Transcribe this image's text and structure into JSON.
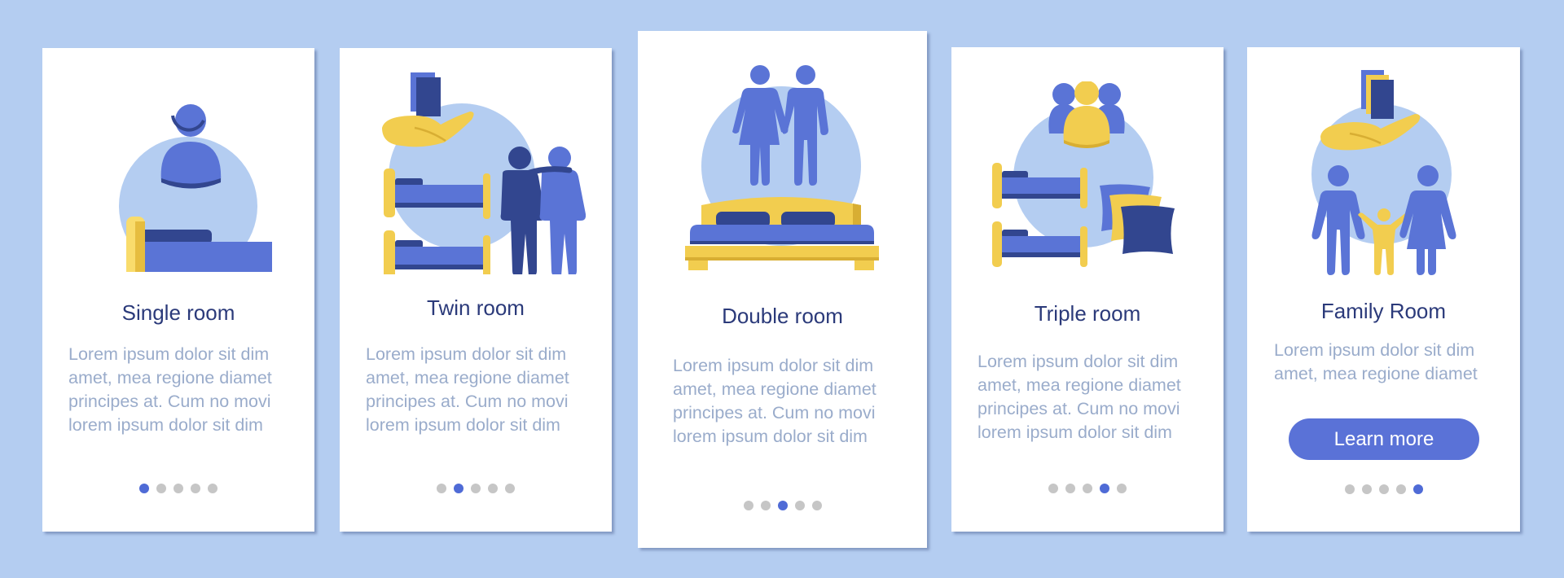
{
  "colors": {
    "background": "#b4cdf1",
    "card": "#ffffff",
    "title": "#2b3a7a",
    "body_text": "#9aaccb",
    "accent": "#5a72d7",
    "dot_active": "#4f6bd6",
    "dot_inactive": "#c6c6c6",
    "illustration_blue": "#5a74d6",
    "illustration_dark_blue": "#32468f",
    "illustration_yellow": "#f2cd4f",
    "illustration_circle": "#b4cdf1"
  },
  "total_pages": 5,
  "cards": [
    {
      "illustration": "single-bed-person-icon",
      "title": "Single room",
      "lines": [
        "Lorem ipsum dolor sit dim",
        "amet, mea regione diamet",
        "principes at. Cum no movi",
        "lorem ipsum dolor sit dim"
      ],
      "active_page": 1
    },
    {
      "illustration": "twin-beds-two-people-icon",
      "title": "Twin room",
      "lines": [
        "Lorem ipsum dolor sit dim",
        "amet, mea regione diamet",
        "principes at. Cum no movi",
        "lorem ipsum dolor sit dim"
      ],
      "active_page": 2
    },
    {
      "illustration": "double-bed-couple-icon",
      "title": "Double room",
      "lines": [
        "Lorem ipsum dolor sit dim",
        "amet, mea regione diamet",
        "principes at. Cum no movi",
        "lorem ipsum dolor sit dim"
      ],
      "active_page": 3
    },
    {
      "illustration": "triple-room-group-pillows-icon",
      "title": "Triple room",
      "lines": [
        "Lorem ipsum dolor sit dim",
        "amet, mea regione diamet",
        "principes at. Cum no movi",
        "lorem ipsum dolor sit dim"
      ],
      "active_page": 4
    },
    {
      "illustration": "family-hand-icon",
      "title": "Family Room",
      "lines": [
        "Lorem ipsum dolor sit dim",
        "amet, mea regione diamet"
      ],
      "button_label": "Learn more",
      "active_page": 5
    }
  ]
}
